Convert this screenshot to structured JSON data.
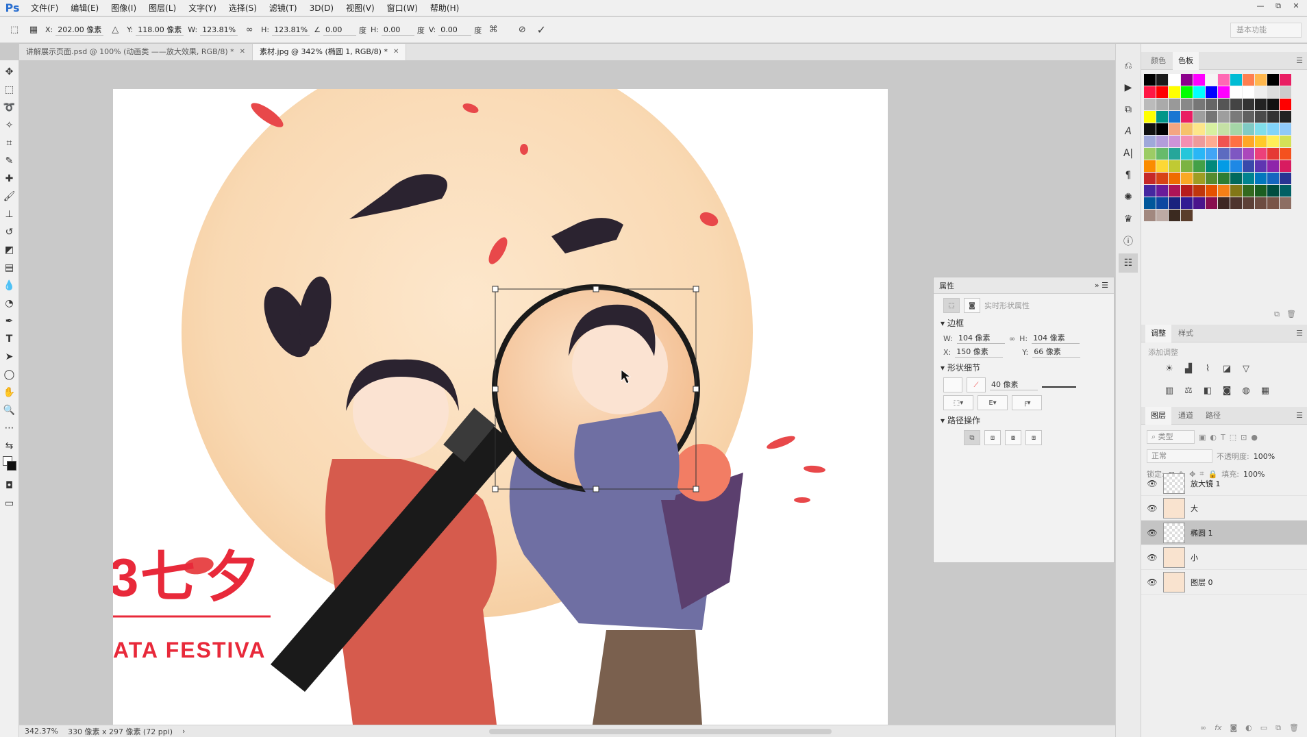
{
  "app": {
    "logo": "Ps"
  },
  "menu": [
    "文件(F)",
    "编辑(E)",
    "图像(I)",
    "图层(L)",
    "文字(Y)",
    "选择(S)",
    "滤镜(T)",
    "3D(D)",
    "视图(V)",
    "窗口(W)",
    "帮助(H)"
  ],
  "window_controls": {
    "minimize": "—",
    "restore": "⧉",
    "close": "✕"
  },
  "options": {
    "x_label": "X:",
    "x_value": "202.00 像素",
    "y_label": "Y:",
    "y_value": "118.00 像素",
    "w_label": "W:",
    "w_value": "123.81%",
    "h_label": "H:",
    "h_value": "123.81%",
    "angle_value": "0.00",
    "angle_unit": "度",
    "hskew_label": "H:",
    "hskew_value": "0.00",
    "hskew_unit": "度",
    "vskew_label": "V:",
    "vskew_value": "0.00",
    "vskew_unit": "度",
    "workspace": "基本功能"
  },
  "tabs": [
    {
      "label": "讲解展示页面.psd @ 100% (动画类 ——放大效果, RGB/8) *",
      "active": false
    },
    {
      "label": "素材.jpg @ 342% (椭圆 1, RGB/8) *",
      "active": true
    }
  ],
  "canvas_text": {
    "title_cn": "七夕",
    "title_prefix": "3",
    "subtitle_en": "ATA FESTIVA"
  },
  "status": {
    "zoom": "342.37%",
    "doc_info": "330 像素 x 297 像素 (72 ppi)"
  },
  "properties": {
    "title": "属性",
    "subtitle": "实时形状属性",
    "section_bounds": "边框",
    "w_label": "W:",
    "w_value": "104 像素",
    "h_label": "H:",
    "h_value": "104 像素",
    "x_label": "X:",
    "x_value": "150 像素",
    "y_label": "Y:",
    "y_value": "66 像素",
    "section_shape": "形状细节",
    "stroke_width": "40 像素",
    "section_path": "路径操作"
  },
  "color_panel": {
    "tabs": [
      "颜色",
      "色板"
    ]
  },
  "adjust_panel": {
    "tabs": [
      "调整",
      "样式"
    ],
    "hint": "添加调整"
  },
  "layers_panel": {
    "tabs": [
      "图层",
      "通道",
      "路径"
    ],
    "filter": "类型",
    "blend": "正常",
    "opacity_label": "不透明度:",
    "opacity_value": "100%",
    "lock_label": "锁定:",
    "fill_label": "填充:",
    "fill_value": "100%",
    "layers": [
      {
        "name": "放大镜 1",
        "selected": false
      },
      {
        "name": "大",
        "selected": false
      },
      {
        "name": "椭圆 1",
        "selected": true
      },
      {
        "name": "小",
        "selected": false
      },
      {
        "name": "图层 0",
        "selected": false
      }
    ]
  },
  "swatch_colors": [
    "#000000",
    "#1a1a1a",
    "#ffffff",
    "#8b008b",
    "#ff00ff",
    "#f5f5f5",
    "#ff69b4",
    "#00bcd4",
    "#ff7f50",
    "#ffb74d",
    "#000000",
    "#e91e63",
    "#ff1744",
    "#ff0000",
    "#ffff00",
    "#00ff00",
    "#00ffff",
    "#0000ff",
    "#ff00ff",
    "#ffffff",
    "#ffffff",
    "#eeeeee",
    "#dddddd",
    "#cccccc",
    "#bbbbbb",
    "#aaaaaa",
    "#999999",
    "#888888",
    "#777777",
    "#666666",
    "#555555",
    "#444444",
    "#333333",
    "#222222",
    "#111111",
    "#ff0000",
    "#ffff00",
    "#009688",
    "#1976d2",
    "#e91e63",
    "#9e9e9e",
    "#757575",
    "#9e9e9e",
    "#7a7a7a",
    "#606060",
    "#4a4a4a",
    "#333333",
    "#222222",
    "#111111",
    "#000000",
    "#f4a582",
    "#f6c26b",
    "#fde68a",
    "#d7f0a0",
    "#c5e1a5",
    "#a5d6a7",
    "#80cbc4",
    "#80deea",
    "#81d4fa",
    "#90caf9",
    "#9fa8da",
    "#b39ddb",
    "#ce93d8",
    "#f48fb1",
    "#ef9a9a",
    "#ffab91",
    "#ef5350",
    "#ff7043",
    "#ffa726",
    "#ffca28",
    "#ffee58",
    "#d4e157",
    "#9ccc65",
    "#66bb6a",
    "#26a69a",
    "#26c6da",
    "#29b6f6",
    "#42a5f5",
    "#5c6bc0",
    "#7e57c2",
    "#ab47bc",
    "#ec407a",
    "#e53935",
    "#f4511e",
    "#fb8c00",
    "#fdd835",
    "#c0ca33",
    "#7cb342",
    "#43a047",
    "#00897b",
    "#039be5",
    "#1e88e5",
    "#3949ab",
    "#5e35b1",
    "#8e24aa",
    "#d81b60",
    "#c62828",
    "#d84315",
    "#ef6c00",
    "#f9a825",
    "#9e9d24",
    "#558b2f",
    "#2e7d32",
    "#00695c",
    "#00838f",
    "#0277bd",
    "#1565c0",
    "#283593",
    "#4527a0",
    "#6a1b9a",
    "#ad1457",
    "#b71c1c",
    "#bf360c",
    "#e65100",
    "#f57f17",
    "#827717",
    "#33691e",
    "#1b5e20",
    "#004d40",
    "#006064",
    "#01579b",
    "#0d47a1",
    "#1a237e",
    "#311b92",
    "#4a148c",
    "#880e4f",
    "#3e2723",
    "#4e342e",
    "#5d4037",
    "#6d4c41",
    "#795548",
    "#8d6e63",
    "#a1887f",
    "#bcaaa4",
    "#3b2a20",
    "#5a3d2b"
  ]
}
